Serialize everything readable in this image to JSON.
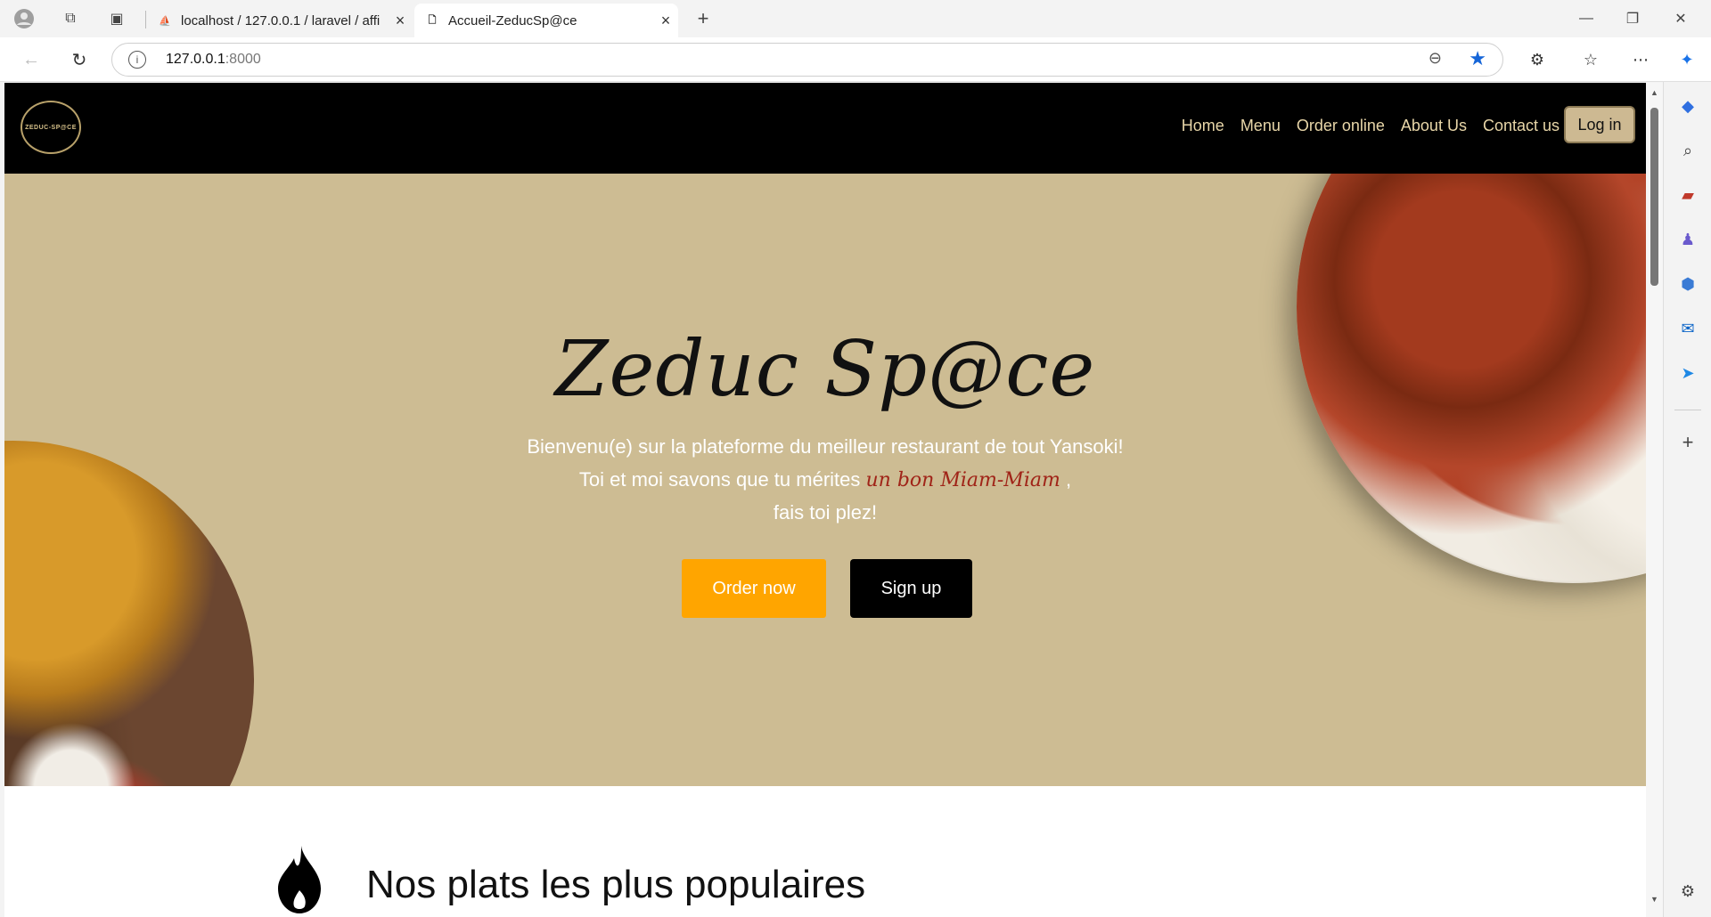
{
  "browser": {
    "tabs": [
      {
        "label": "localhost / 127.0.0.1 / laravel / affi",
        "favicon": "PMA"
      },
      {
        "label": "Accueil-ZeducSp@ce",
        "favicon": "page-icon"
      }
    ],
    "url_host": "127.0.0.1",
    "url_port": ":8000"
  },
  "site": {
    "logo_text": "ZEDUC-SP@CE",
    "nav": [
      "Home",
      "Menu",
      "Order online",
      "About Us",
      "Contact us"
    ],
    "login_label": "Log in"
  },
  "hero": {
    "title": "Zeduc Sp@ce",
    "line1": "Bienvenu(e) sur la plateforme du meilleur restaurant de tout Yansoki!",
    "line2_prefix": "Toi et moi savons que tu mérites ",
    "line2_highlight": "un bon Miam-Miam",
    "line2_suffix": " ,",
    "line3": "fais toi plez!",
    "order_label": "Order now",
    "signup_label": "Sign up"
  },
  "section": {
    "title": "Nos plats les plus populaires"
  },
  "colors": {
    "hero_bg": "#cdbc93",
    "order_btn": "#ffa500",
    "nav_text": "#e8d6a8"
  }
}
